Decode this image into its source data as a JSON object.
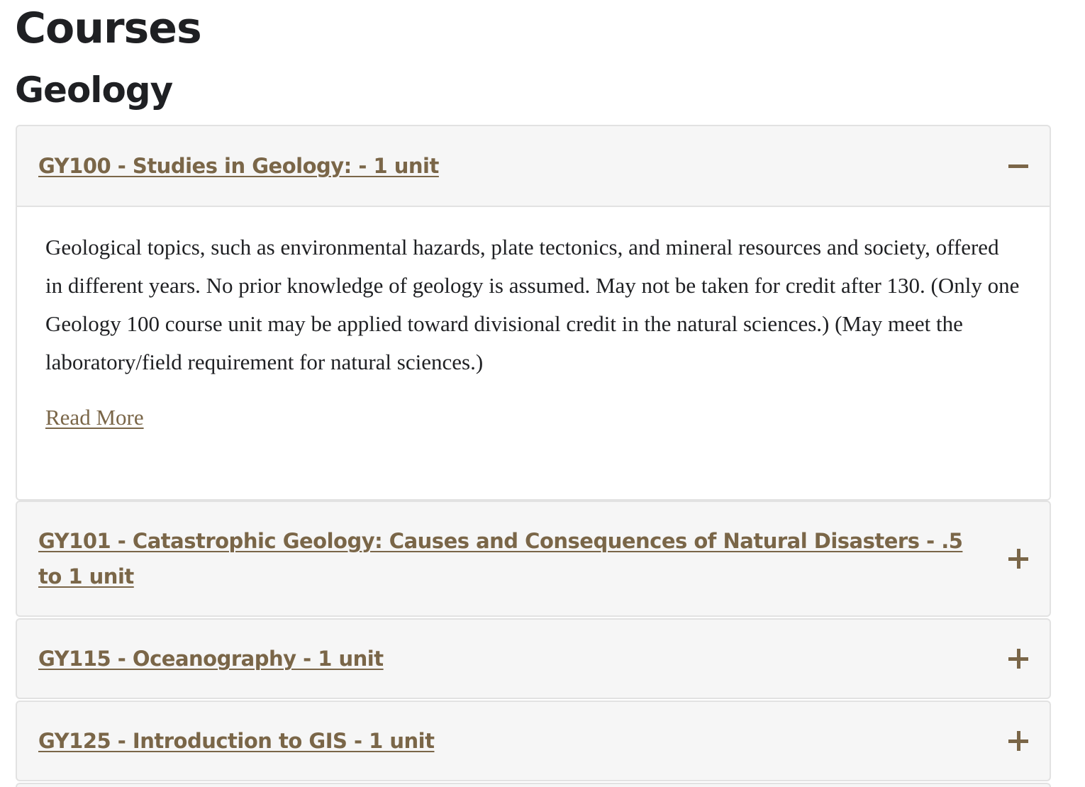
{
  "page": {
    "title": "Courses",
    "section": "Geology"
  },
  "courses": [
    {
      "title": "GY100 - Studies in Geology: - 1 unit",
      "expanded": true,
      "description": "Geological topics, such as environmental hazards, plate tectonics, and mineral resources and society, offered in different years. No prior knowledge of geology is assumed. May not be taken for credit after 130. (Only one Geology 100 course unit may be applied toward divisional credit in the natural sciences.) (May meet the laboratory/field requirement for natural sciences.)",
      "read_more": "Read More"
    },
    {
      "title": "GY101 - Catastrophic Geology: Causes and Consequences of Natural Disasters - .5 to 1 unit",
      "expanded": false
    },
    {
      "title": "GY115 - Oceanography - 1 unit",
      "expanded": false
    },
    {
      "title": "GY125 - Introduction to GIS - 1 unit",
      "expanded": false
    }
  ],
  "colors": {
    "accent": "#7a6648",
    "text": "#1f2023",
    "panel_bg": "#f6f6f6",
    "border": "#e2e2e2"
  },
  "icons": {
    "expanded": "minus-icon",
    "collapsed": "plus-icon"
  }
}
